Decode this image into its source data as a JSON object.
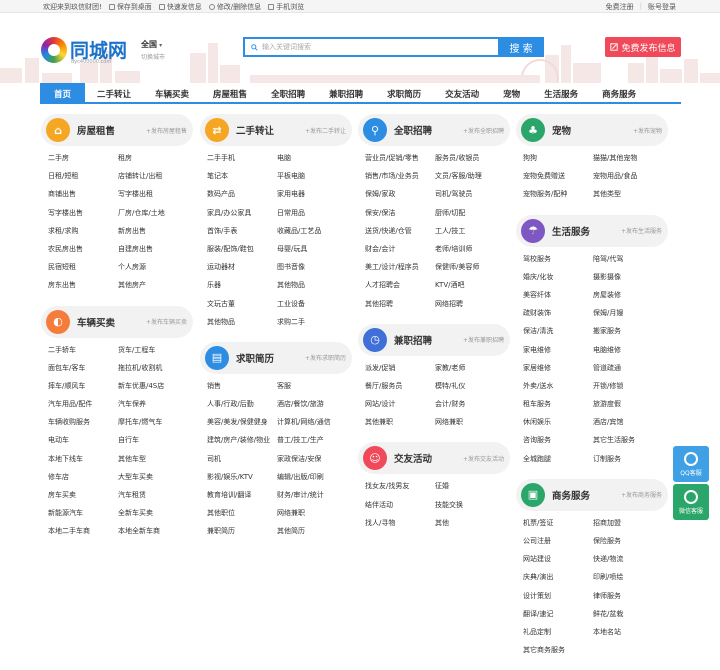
{
  "topbar": {
    "links": [
      {
        "label": "欢迎来到玖信财团!"
      },
      {
        "label": "保存到桌面",
        "icon": "desktop-icon"
      },
      {
        "label": "快速发信息",
        "icon": "lightning-icon"
      },
      {
        "label": "修改/删除信息",
        "icon": "edit-icon"
      },
      {
        "label": "手机浏览",
        "icon": "phone-icon"
      }
    ],
    "register": "免费注册",
    "login": "账号登录"
  },
  "logo": {
    "name": "同城网",
    "url": "dyc400000.com"
  },
  "city": {
    "name": "全国",
    "switch": "切换城市"
  },
  "search": {
    "placeholder": "输入关键词搜索",
    "button": "搜 索"
  },
  "post_button": "免费发布信息",
  "nav": [
    "首页",
    "二手转让",
    "车辆买卖",
    "房屋租售",
    "全职招聘",
    "兼职招聘",
    "求职简历",
    "交友活动",
    "宠物",
    "生活服务",
    "商务服务"
  ],
  "panels": {
    "house": {
      "title": "房屋租售",
      "pub": "+发布房屋租售",
      "items": [
        "二手房",
        "租房",
        "日租/短租",
        "店铺转让/出租",
        "商铺出售",
        "写字楼出租",
        "写字楼出售",
        "厂房/仓库/土地",
        "求租/求购",
        "新房出售",
        "农民房出售",
        "自建房出售",
        "民宿短租",
        "个人房源",
        "房东出售",
        "其他房产"
      ]
    },
    "car": {
      "title": "车辆买卖",
      "pub": "+发布车辆买卖",
      "items": [
        "二手轿车",
        "货车/工程车",
        "面包车/客车",
        "拖拉机/收割机",
        "摔车/顺风车",
        "新车优惠/4S店",
        "汽车用品/配件",
        "汽车保养",
        "车辆收购服务",
        "摩托车/燃气车",
        "电动车",
        "自行车",
        "本地下线车",
        "其他车型",
        "修车店",
        "大型车买卖",
        "房车买卖",
        "汽车租赁",
        "新能源汽车",
        "全新车买卖",
        "本地二手车商",
        "本地全新车商"
      ]
    },
    "secondhand": {
      "title": "二手转让",
      "pub": "+发布二手转让",
      "items": [
        "二手手机",
        "电脑",
        "笔记本",
        "平板电脑",
        "数码产品",
        "家用电器",
        "家具/办公家具",
        "日常用品",
        "首饰/手表",
        "收藏品/工艺品",
        "服装/配饰/鞋包",
        "母婴/玩具",
        "运动器材",
        "图书音像",
        "乐器",
        "其他物品",
        "文玩古董",
        "工业设备",
        "其他物品",
        "求购二手"
      ]
    },
    "resume": {
      "title": "求职简历",
      "pub": "+发布求职简历",
      "items": [
        "销售",
        "客服",
        "人事/行政/后勤",
        "酒店/餐饮/旅游",
        "美容/美发/保健健身",
        "计算机/网络/通信",
        "建筑/房产/装修/物业",
        "普工/技工/生产",
        "司机",
        "家政保洁/安保",
        "影视/娱乐/KTV",
        "编辑/出版/印刷",
        "教育培训/翻译",
        "财务/审计/统计",
        "其他职位",
        "网络兼职",
        "兼职简历",
        "其他简历"
      ]
    },
    "fulltime": {
      "title": "全职招聘",
      "pub": "+发布全职招聘",
      "items": [
        "营业员/促销/零售",
        "服务员/收银员",
        "销售/市场/业务员",
        "文员/客服/助理",
        "保姆/家政",
        "司机/驾驶员",
        "保安/保洁",
        "厨师/切配",
        "送货/快递/仓管",
        "工人/技工",
        "财会/会计",
        "老师/培训师",
        "美工/设计/程序员",
        "保健师/美容师",
        "人才招聘会",
        "KTV/酒吧",
        "其他招聘",
        "网络招聘"
      ]
    },
    "parttime": {
      "title": "兼职招聘",
      "pub": "+发布兼职招聘",
      "items": [
        "派发/促销",
        "家教/老师",
        "餐厅/服务员",
        "模特/礼仪",
        "网站/设计",
        "会计/财务",
        "其他兼职",
        "网络兼职"
      ]
    },
    "dating": {
      "title": "交友活动",
      "pub": "+发布交友活动",
      "items": [
        "找女友/找男友",
        "征婚",
        "结伴活动",
        "技能交换",
        "找人/寻物",
        "其他"
      ]
    },
    "pet": {
      "title": "宠物",
      "pub": "+发布宠物",
      "items": [
        "狗狗",
        "猫猫/其他宠物",
        "宠物免费赠送",
        "宠物用品/食品",
        "宠物服务/配种",
        "其他类型"
      ]
    },
    "life": {
      "title": "生活服务",
      "pub": "+发布生活服务",
      "items": [
        "驾校服务",
        "陪驾/代驾",
        "婚庆/化妆",
        "摄影摄像",
        "美容纤体",
        "房屋装修",
        "疏财装饰",
        "保姆/月嫂",
        "保洁/清洗",
        "搬家服务",
        "家电维修",
        "电脑维修",
        "家居维修",
        "管道疏通",
        "外卖/送水",
        "开锁/修锁",
        "租车服务",
        "旅游度假",
        "休闲娱乐",
        "酒店/宾馆",
        "咨询服务",
        "其它生活服务",
        "全城跑腿",
        "订制服务"
      ]
    },
    "business": {
      "title": "商务服务",
      "pub": "+发布商务服务",
      "items": [
        "机票/签证",
        "招商加盟",
        "公司注册",
        "保险服务",
        "网站建设",
        "快递/物流",
        "庆典/演出",
        "印刷/喷绘",
        "设计策划",
        "律师服务",
        "翻译/速记",
        "鲜花/盆栽",
        "礼品定制",
        "本地名站",
        "其它商务服务"
      ]
    }
  },
  "float": {
    "qq": "QQ客服",
    "wechat": "微信客服"
  },
  "colors": {
    "primary": "#2d8de3",
    "accent": "#f04a5a",
    "house": "#f5a623",
    "car": "#f57c3a",
    "secondhand": "#f5a623",
    "resume": "#2d8de3",
    "fulltime": "#2d8de3",
    "parttime": "#3f6fd8",
    "dating": "#f04a5a",
    "pet": "#2aa66a",
    "life": "#7e57c2",
    "business": "#2aa66a"
  }
}
